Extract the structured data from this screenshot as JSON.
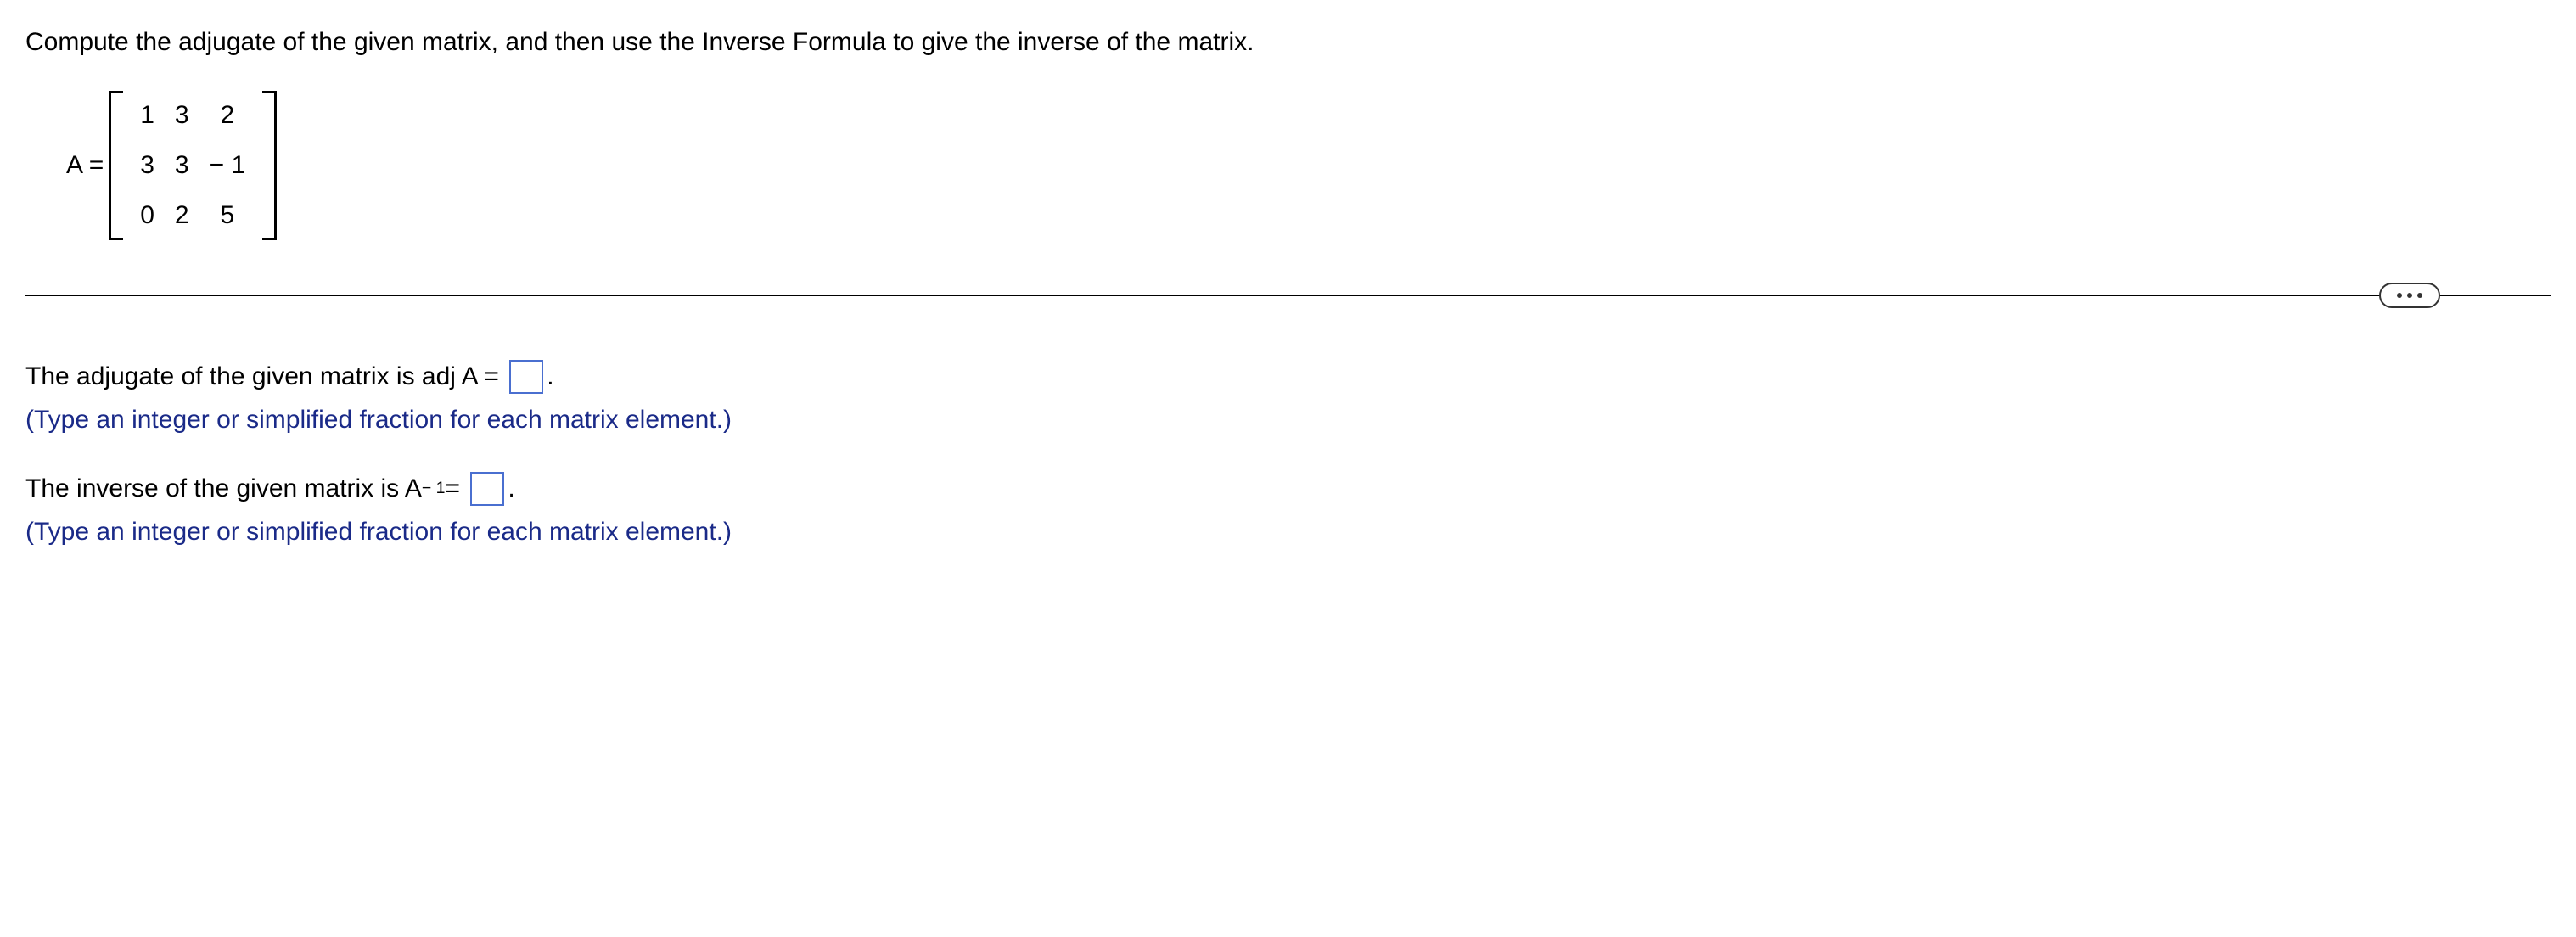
{
  "question": "Compute the adjugate of the given matrix, and then use the Inverse Formula to give the inverse of the matrix.",
  "matrix_label": "A =",
  "matrix": {
    "rows": [
      [
        "1",
        "3",
        "2"
      ],
      [
        "3",
        "3",
        "− 1"
      ],
      [
        "0",
        "2",
        "5"
      ]
    ]
  },
  "answers": {
    "adj_prefix": "The adjugate of the given matrix is adj A =",
    "adj_suffix": ".",
    "adj_hint": "(Type an integer or simplified fraction for each matrix element.)",
    "inv_prefix_a": "The inverse of the given matrix is A",
    "inv_exp": "− 1",
    "inv_prefix_b": " =",
    "inv_suffix": ".",
    "inv_hint": "(Type an integer or simplified fraction for each matrix element.)"
  },
  "icons": {
    "more": "more-options"
  }
}
